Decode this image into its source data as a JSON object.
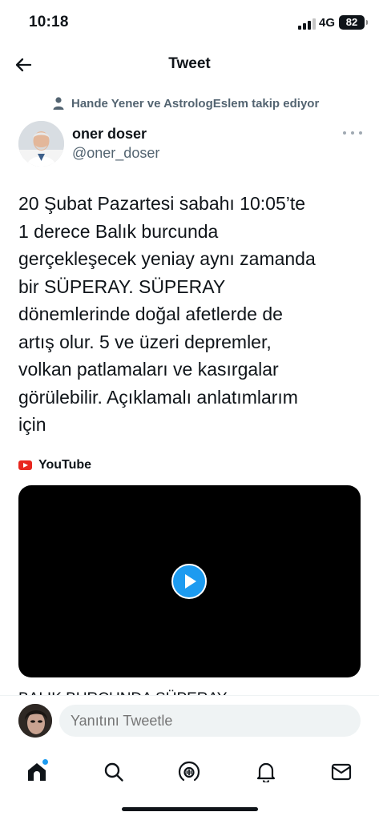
{
  "status_bar": {
    "time": "10:18",
    "network": "4G",
    "battery": "82"
  },
  "header": {
    "title": "Tweet"
  },
  "tweet": {
    "social_context": "Hande Yener ve AstrologEslem takip ediyor",
    "author": {
      "name": "oner doser",
      "handle": "@oner_doser"
    },
    "text_lines": [
      "20 Şubat Pazartesi sabahı 10:05’te",
      "1 derece Balık burcunda",
      "gerçekleşecek yeniay aynı zamanda",
      "bir SÜPERAY. SÜPERAY",
      "dönemlerinde doğal afetlerde de",
      "artış olur. 5 ve üzeri depremler,",
      "volkan patlamaları ve kasırgalar",
      "görülebilir. Açıklamalı anlatımlarım",
      "için"
    ],
    "card": {
      "source": "YouTube",
      "title": "BALIK BURCUNDA SÜPERAY"
    }
  },
  "reply": {
    "placeholder": "Yanıtını Tweetle"
  },
  "colors": {
    "accent": "#1d9bf0",
    "text": "#0f1419",
    "secondary": "#536471",
    "youtube_red": "#e8271f"
  },
  "icons": {
    "back": "arrow-left-icon",
    "social": "person-icon",
    "more": "ellipsis-icon",
    "play": "play-icon",
    "tabs": [
      "home-icon",
      "search-icon",
      "spaces-icon",
      "bell-icon",
      "mail-icon"
    ]
  }
}
